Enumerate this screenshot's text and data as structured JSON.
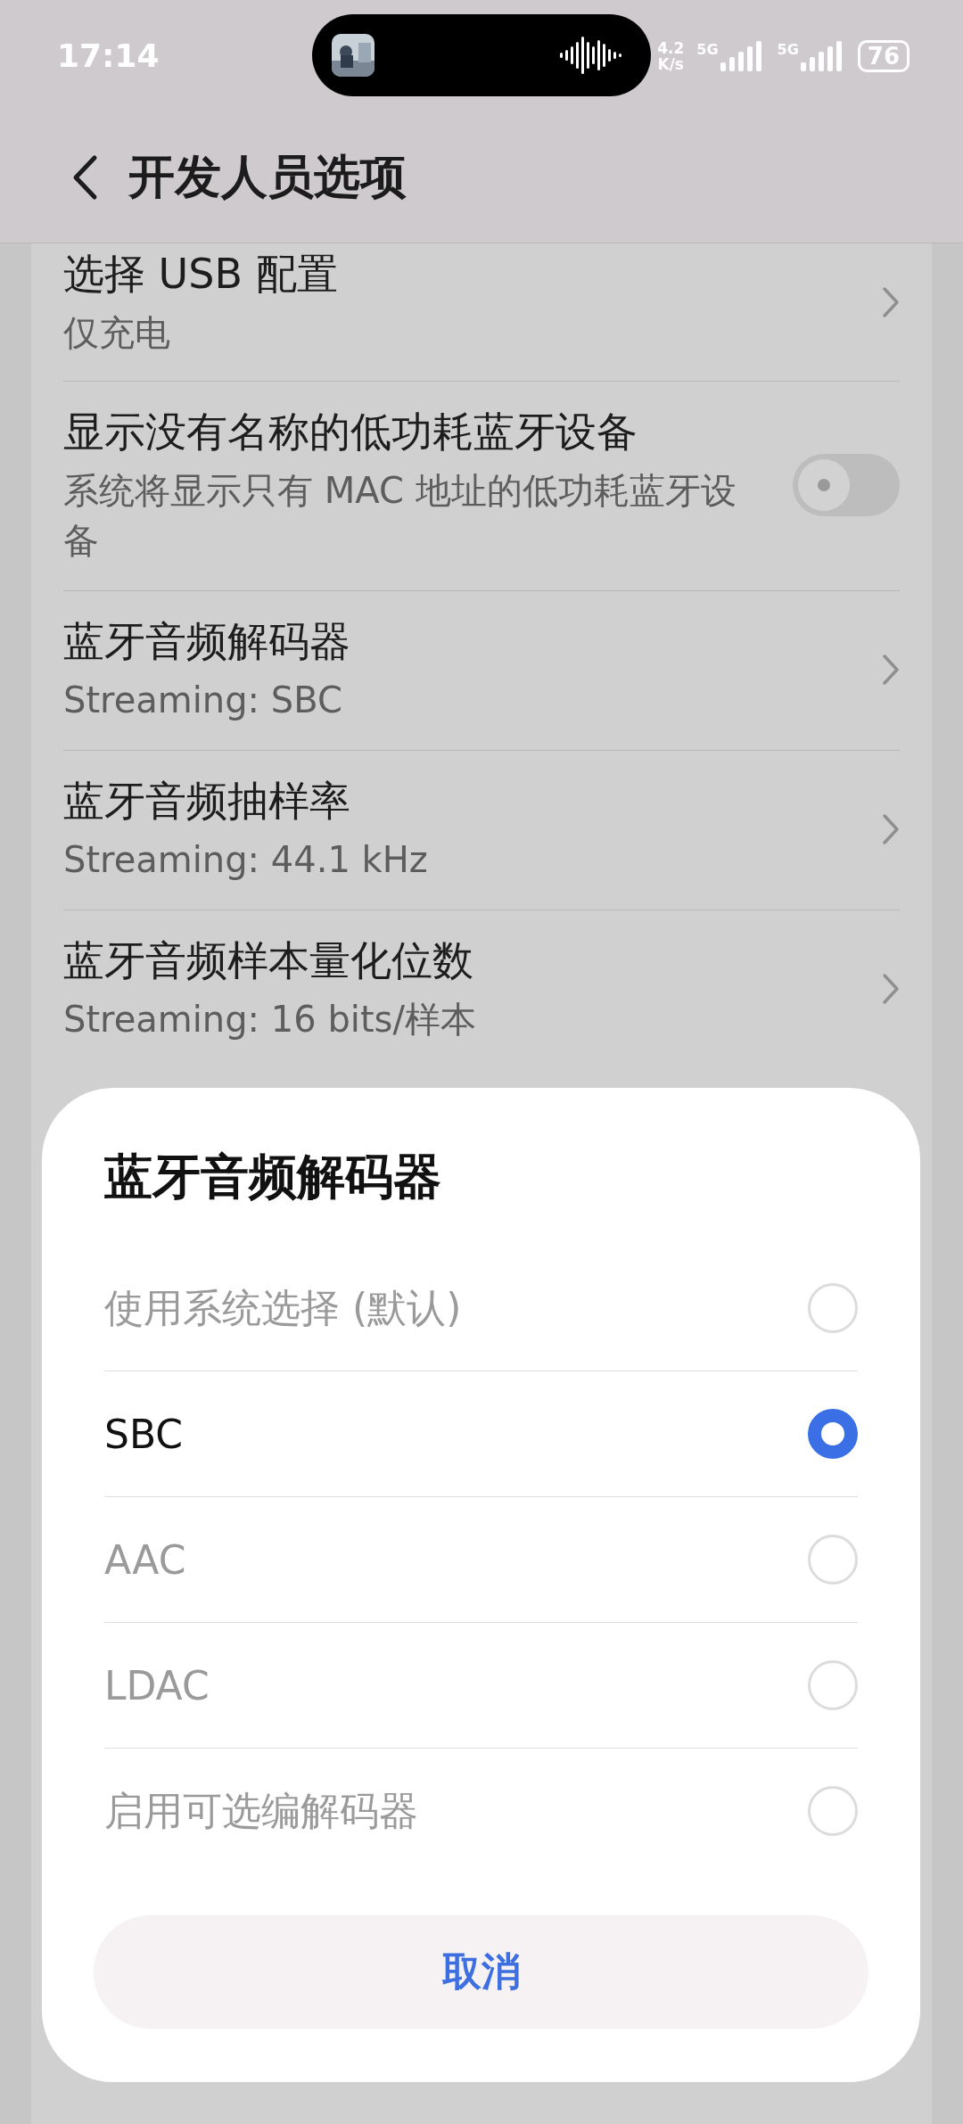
{
  "status_bar": {
    "time": "17:14",
    "net_speed_value": "4.2",
    "net_speed_unit": "K/s",
    "sim_1": "5G",
    "sim_2": "5G",
    "battery": "76"
  },
  "header": {
    "title": "开发人员选项"
  },
  "settings": [
    {
      "kind": "link",
      "title": "选择 USB 配置",
      "subtitle": "仅充电"
    },
    {
      "kind": "toggle",
      "title": "显示没有名称的低功耗蓝牙设备",
      "subtitle": "系统将显示只有 MAC 地址的低功耗蓝牙设备",
      "on": false
    },
    {
      "kind": "link",
      "title": "蓝牙音频解码器",
      "subtitle": "Streaming: SBC"
    },
    {
      "kind": "link",
      "title": "蓝牙音频抽样率",
      "subtitle": "Streaming: 44.1 kHz"
    },
    {
      "kind": "link",
      "title": "蓝牙音频样本量化位数",
      "subtitle": "Streaming: 16 bits/样本"
    }
  ],
  "dialog": {
    "title": "蓝牙音频解码器",
    "options": [
      {
        "label": "使用系统选择 (默认)",
        "selected": false,
        "disabled": true
      },
      {
        "label": "SBC",
        "selected": true,
        "disabled": false
      },
      {
        "label": "AAC",
        "selected": false,
        "disabled": true
      },
      {
        "label": "LDAC",
        "selected": false,
        "disabled": true
      },
      {
        "label": "启用可选编解码器",
        "selected": false,
        "disabled": true
      }
    ],
    "cancel": "取消"
  }
}
